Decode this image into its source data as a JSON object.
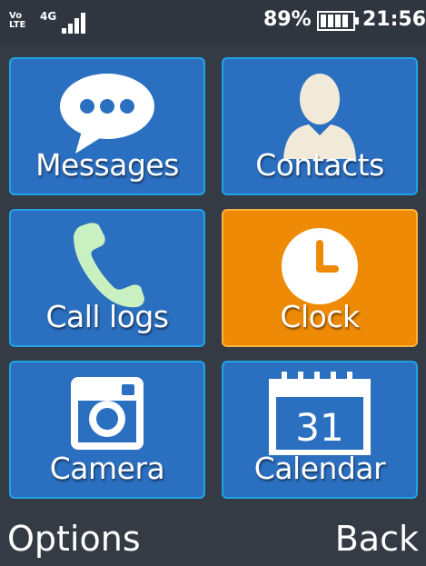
{
  "status_bar": {
    "volte_top": "Vo",
    "volte_bottom": "LTE",
    "network": "4G",
    "battery_percent": "89%",
    "time": "21:56"
  },
  "tiles": [
    {
      "label": "Messages",
      "icon": "speech-bubble-icon"
    },
    {
      "label": "Contacts",
      "icon": "person-icon"
    },
    {
      "label": "Call logs",
      "icon": "phone-handset-icon"
    },
    {
      "label": "Clock",
      "icon": "clock-icon",
      "selected": true
    },
    {
      "label": "Camera",
      "icon": "camera-icon"
    },
    {
      "label": "Calendar",
      "icon": "calendar-icon",
      "day": "31"
    }
  ],
  "softkeys": {
    "left": "Options",
    "right": "Back"
  },
  "colors": {
    "background": "#343b45",
    "tile": "#2b6fc0",
    "tile_border": "#1fa3e6",
    "selected_tile": "#ef8a06"
  }
}
